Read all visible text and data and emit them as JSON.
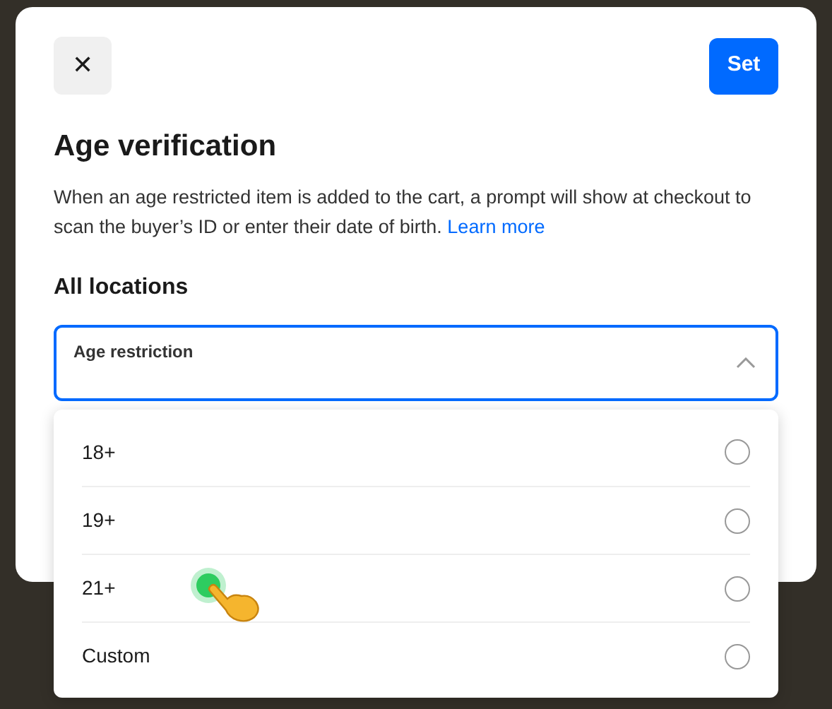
{
  "dialog": {
    "close_label": "✕",
    "action_button": "Set",
    "title": "Age verification",
    "description": "When an age restricted item is added to the cart, a prompt will show at checkout to scan the buyer’s ID or enter their date of birth.",
    "link": "Learn more",
    "section_title": "All locations",
    "field": {
      "label": "Age restriction",
      "expanded": true
    },
    "options": [
      {
        "label": "18+",
        "selected": false
      },
      {
        "label": "19+",
        "selected": false
      },
      {
        "label": "21+",
        "selected": false
      },
      {
        "label": "Custom",
        "selected": false
      }
    ]
  }
}
